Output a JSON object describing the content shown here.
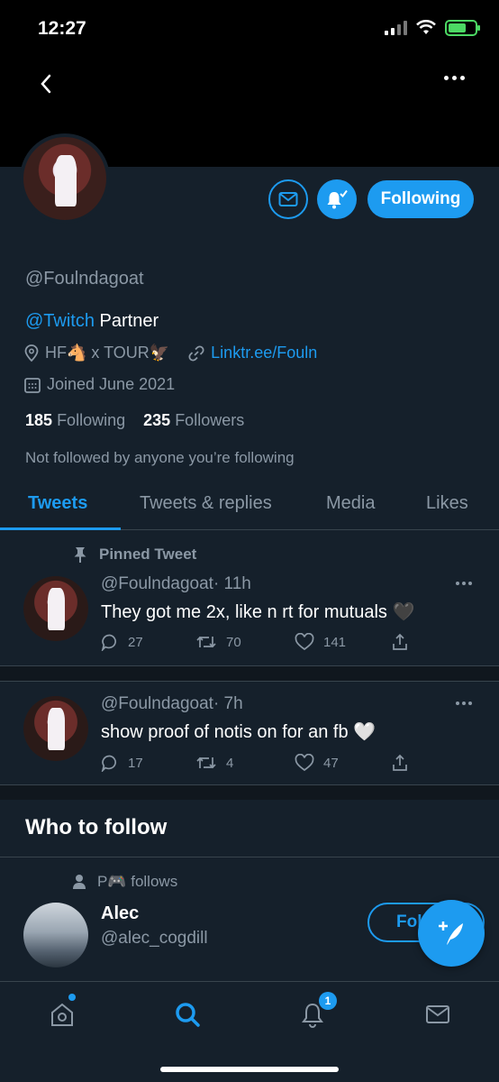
{
  "status_bar": {
    "time": "12:27"
  },
  "profile": {
    "handle": "@Foulndagoat",
    "bio_link": "@Twitch",
    "bio_rest": " Partner",
    "location": "HF🐴 x TOUR🦅",
    "website": "Linktr.ee/Fouln",
    "joined": "Joined June 2021",
    "following_count": "185",
    "following_label": "Following",
    "followers_count": "235",
    "followers_label": "Followers",
    "not_followed": "Not followed by anyone you’re following",
    "following_button": "Following"
  },
  "tabs": [
    "Tweets",
    "Tweets & replies",
    "Media",
    "Likes"
  ],
  "tweets": [
    {
      "pinned_label": "Pinned Tweet",
      "handle": "@Foulndagoat",
      "time": "· 11h",
      "text": "They got me 2x, like n rt for mutuals 🖤",
      "replies": "27",
      "retweets": "70",
      "likes": "141"
    },
    {
      "handle": "@Foulndagoat",
      "time": "· 7h",
      "text": "show proof of notis on for an fb 🤍",
      "replies": "17",
      "retweets": "4",
      "likes": "47"
    }
  ],
  "who_to_follow": {
    "title": "Who to follow",
    "social_context": "P🎮 follows",
    "name": "Alec",
    "handle": "@alec_cogdill",
    "follow_button": "Fol"
  },
  "tabbar": {
    "notifications_badge": "1"
  },
  "colors": {
    "accent": "#1d9bf0",
    "background": "#15202b",
    "muted": "#8b98a5"
  }
}
